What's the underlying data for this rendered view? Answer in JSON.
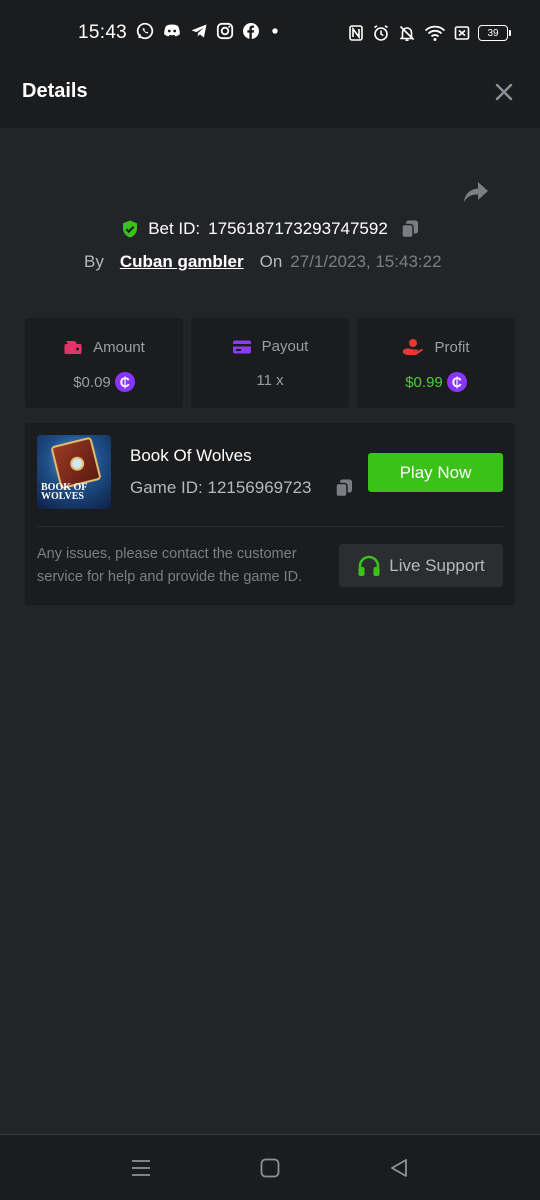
{
  "status_bar": {
    "time": "15:43",
    "battery": "39"
  },
  "header": {
    "title": "Details"
  },
  "bet": {
    "id_label": "Bet ID:",
    "id": "1756187173293747592",
    "by_label": "By",
    "user": "Cuban gambler",
    "on_label": "On",
    "date": "27/1/2023, 15:43:22"
  },
  "stats": {
    "amount": {
      "label": "Amount",
      "value": "$0.09"
    },
    "payout": {
      "label": "Payout",
      "value": "11 x"
    },
    "profit": {
      "label": "Profit",
      "value": "$0.99"
    },
    "coin_symbol": "₵"
  },
  "game": {
    "name": "Book Of Wolves",
    "id_label": "Game ID:",
    "id": "12156969723",
    "thumb_title": "BOOK OF WOLVES",
    "play_label": "Play Now"
  },
  "support": {
    "text": "Any issues, please contact the customer service for help and provide the game ID.",
    "button_label": "Live Support"
  },
  "colors": {
    "accent_green": "#3bc117",
    "coin_purple": "#8a34ff",
    "amount_icon": "#e2346a",
    "payout_icon": "#8b3cf0",
    "profit_icon": "#e53935"
  }
}
